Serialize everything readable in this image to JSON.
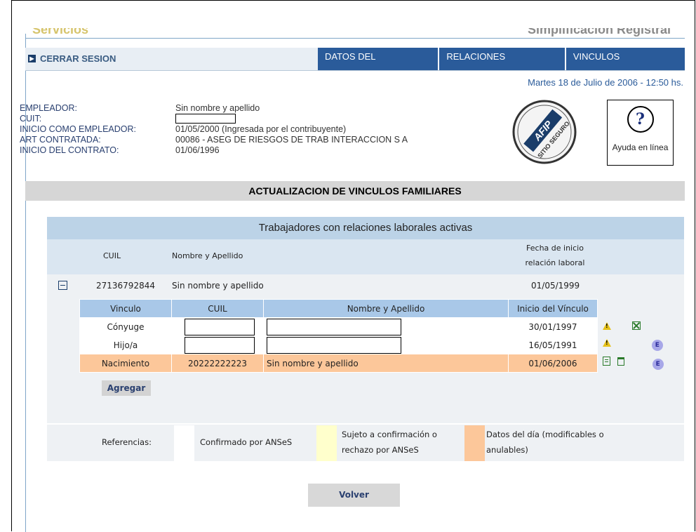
{
  "header": {
    "left_cut_text": "Servicios",
    "right_cut_text": "Simplificación Registral",
    "logout_label": "CERRAR SESION",
    "tabs": [
      "DATOS DEL EMPLEADOR",
      "RELACIONES LABORALES",
      "VINCULOS FAMILIARES"
    ],
    "date": "Martes 18 de Julio de 2006 - 12:50 hs."
  },
  "employer": {
    "labels": {
      "name": "EMPLEADOR:",
      "cuit": "CUIT:",
      "start": "INICIO COMO EMPLEADOR:",
      "art": "ART CONTRATADA:",
      "contract": "INICIO DEL CONTRATO:"
    },
    "name": "Sin nombre y apellido",
    "cuit": "",
    "start": "01/05/2000 (Ingresada por el contribuyente)",
    "art": "00086 - ASEG DE RIESGOS DE TRAB INTERACCION S A",
    "contract": "01/06/1996"
  },
  "help": {
    "label": "Ayuda en línea",
    "glyph": "?"
  },
  "seal": {
    "text_top": "AFIP",
    "text_bottom": "SITIO SEGURO"
  },
  "section_title": "ACTUALIZACION DE VINCULOS FAMILIARES",
  "panel": {
    "title": "Trabajadores con relaciones laborales activas",
    "headers": {
      "cuil": "CUIL",
      "name": "Nombre y Apellido",
      "start_line1": "Fecha de inicio",
      "start_line2": "relación laboral"
    },
    "worker": {
      "cuil": "27136792844",
      "name": "Sin nombre y apellido",
      "start": "01/05/1999"
    },
    "inner_headers": [
      "Vinculo",
      "CUIL",
      "Nombre y Apellido",
      "Inicio del Vínculo"
    ],
    "rows": [
      {
        "vinculo": "Cónyuge",
        "cuil": "",
        "name": "",
        "inicio": "30/01/1997"
      },
      {
        "vinculo": "Hijo/a",
        "cuil": "",
        "name": "",
        "inicio": "16/05/1991"
      },
      {
        "vinculo": "Nacimiento",
        "cuil": "20222222223",
        "name": "Sin nombre y apellido",
        "inicio": "01/06/2006"
      }
    ],
    "add_label": "Agregar",
    "refs": {
      "label": "Referencias:",
      "confirmed": "Confirmado por ANSeS",
      "pending_line1": "Sujeto a confirmación o",
      "pending_line2": "rechazo por ANSeS",
      "today_line1": "Datos del día (modificables o",
      "today_line2": "anulables)"
    },
    "colors": {
      "confirmed": "#ffffff",
      "pending": "#ffffcc",
      "today": "#fcc79a"
    }
  },
  "actions": {
    "e_label": "E"
  },
  "back_label": "Volver"
}
